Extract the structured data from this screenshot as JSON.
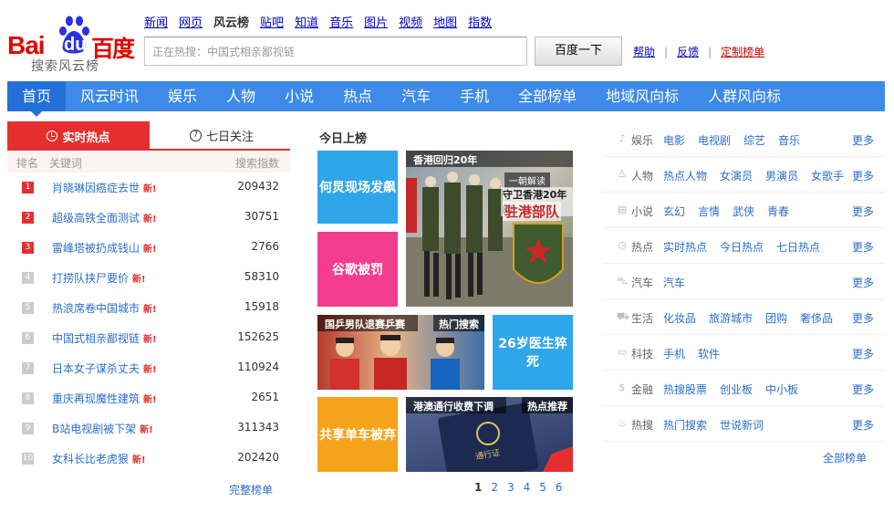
{
  "logo": {
    "bai": "Bai",
    "du": "du",
    "cn": "百度",
    "sub": "搜索风云榜"
  },
  "topnav": [
    "新闻",
    "网页",
    "风云榜",
    "贴吧",
    "知道",
    "音乐",
    "图片",
    "视频",
    "地图",
    "指数"
  ],
  "topnav_current": "风云榜",
  "search": {
    "placeholder": "正在热搜：中国式相亲鄙视链",
    "button": "百度一下"
  },
  "header_links": {
    "help": "帮助",
    "feedback": "反馈",
    "custom": "定制榜单"
  },
  "mainnav": [
    "首页",
    "风云时讯",
    "娱乐",
    "人物",
    "小说",
    "热点",
    "汽车",
    "手机",
    "全部榜单",
    "地域风向标",
    "人群风向标"
  ],
  "left": {
    "tab_hot": "实时热点",
    "tab_week": "七日关注",
    "col_rank": "排名",
    "col_keyword": "关键词",
    "col_index": "搜索指数",
    "new_label": "新!",
    "rows": [
      {
        "rank": "1",
        "keyword": "肖晓琳因癌症去世",
        "index": "209432"
      },
      {
        "rank": "2",
        "keyword": "超级高铁全面测试",
        "index": "30751"
      },
      {
        "rank": "3",
        "keyword": "雷峰塔被扔成钱山",
        "index": "2766"
      },
      {
        "rank": "4",
        "keyword": "打捞队挟尸要价",
        "index": "58310"
      },
      {
        "rank": "5",
        "keyword": "热浪席卷中国城市",
        "index": "15918"
      },
      {
        "rank": "6",
        "keyword": "中国式相亲鄙视链",
        "index": "152625"
      },
      {
        "rank": "7",
        "keyword": "日本女子谋杀丈夫",
        "index": "110924"
      },
      {
        "rank": "8",
        "keyword": "重庆再现魔性建筑",
        "index": "2651"
      },
      {
        "rank": "9",
        "keyword": "B站电视剧被下架",
        "index": "311343"
      },
      {
        "rank": "10",
        "keyword": "女科长比老虎狠",
        "index": "202420"
      }
    ],
    "more": "完整榜单"
  },
  "middle": {
    "title": "今日上榜",
    "tile1": "何炅现场发飙",
    "tile2": "谷歌被罚",
    "photo1_title": "香港回归20年",
    "photo1_caption1": "一朝解读",
    "photo1_caption2": "守卫香港20年的",
    "photo1_caption3": "驻港部队",
    "photo1_badge": "驻港部队",
    "photo2_title": "国乒男队退赛乒赛",
    "photo2_tag": "热门搜索",
    "tile3": "26岁医生猝死",
    "tile4": "共享单车被弃",
    "photo3_title": "港澳通行收费下调",
    "photo3_tag": "热点推荐",
    "photo3_doc": "通行证",
    "pager": [
      "1",
      "2",
      "3",
      "4",
      "5",
      "6"
    ]
  },
  "right": {
    "rows": [
      {
        "icon": "music-icon",
        "cat": "娱乐",
        "links": [
          "电影",
          "电视剧",
          "综艺",
          "音乐"
        ]
      },
      {
        "icon": "person-icon",
        "cat": "人物",
        "links": [
          "热点人物",
          "女演员",
          "男演员",
          "女歌手"
        ]
      },
      {
        "icon": "book-icon",
        "cat": "小说",
        "links": [
          "玄幻",
          "言情",
          "武侠",
          "青春"
        ]
      },
      {
        "icon": "clock-icon",
        "cat": "热点",
        "links": [
          "实时热点",
          "今日热点",
          "七日热点"
        ]
      },
      {
        "icon": "car-icon",
        "cat": "汽车",
        "links": [
          "汽车"
        ]
      },
      {
        "icon": "cart-icon",
        "cat": "生活",
        "links": [
          "化妆品",
          "旅游城市",
          "团购",
          "奢侈品"
        ]
      },
      {
        "icon": "monitor-icon",
        "cat": "科技",
        "links": [
          "手机",
          "软件"
        ]
      },
      {
        "icon": "dollar-icon",
        "cat": "金融",
        "links": [
          "热搜股票",
          "创业板",
          "中小板"
        ]
      },
      {
        "icon": "fire-icon",
        "cat": "热搜",
        "links": [
          "热门搜索",
          "世说新词"
        ]
      }
    ],
    "more": "更多",
    "all": "全部榜单"
  }
}
